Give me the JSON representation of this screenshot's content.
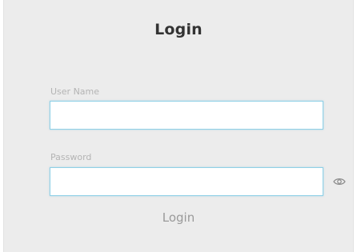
{
  "form": {
    "title": "Login",
    "username": {
      "label": "User Name",
      "value": ""
    },
    "password": {
      "label": "Password",
      "value": "",
      "toggle_icon": "eye-icon"
    },
    "submit_label": "Login"
  }
}
